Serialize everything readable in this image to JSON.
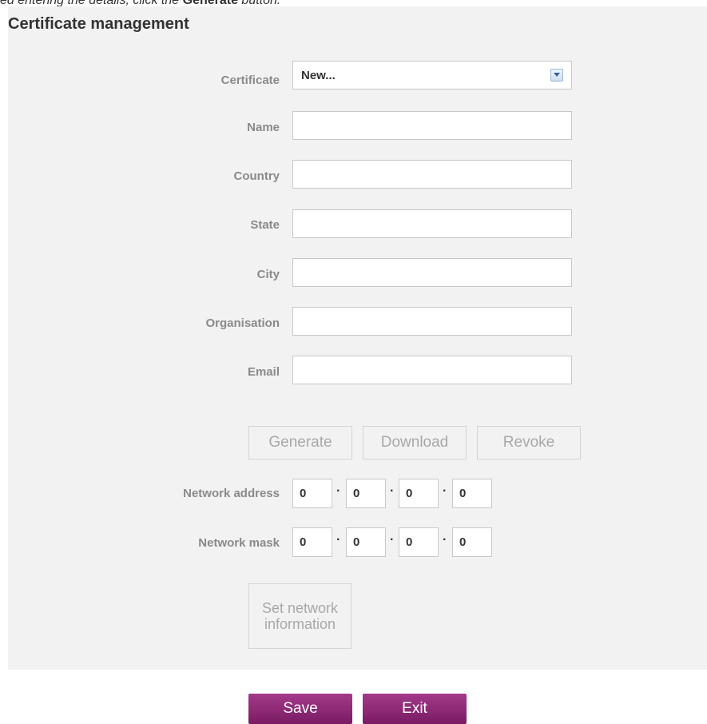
{
  "intro": {
    "before": "ed entering the details, click the",
    "button_ref": "Generate",
    "after": "button."
  },
  "panel": {
    "title": "Certificate management"
  },
  "form": {
    "certificate": {
      "label": "Certificate",
      "value": "New..."
    },
    "name": {
      "label": "Name",
      "value": ""
    },
    "country": {
      "label": "Country",
      "value": ""
    },
    "state": {
      "label": "State",
      "value": ""
    },
    "city": {
      "label": "City",
      "value": ""
    },
    "organisation": {
      "label": "Organisation",
      "value": ""
    },
    "email": {
      "label": "Email",
      "value": ""
    }
  },
  "actions": {
    "generate": "Generate",
    "download": "Download",
    "revoke": "Revoke"
  },
  "network": {
    "address": {
      "label": "Network address",
      "octets": [
        "0",
        "0",
        "0",
        "0"
      ]
    },
    "mask": {
      "label": "Network mask",
      "octets": [
        "0",
        "0",
        "0",
        "0"
      ]
    },
    "separator": "·",
    "set_button": "Set network information"
  },
  "footer": {
    "save": "Save",
    "exit": "Exit"
  }
}
